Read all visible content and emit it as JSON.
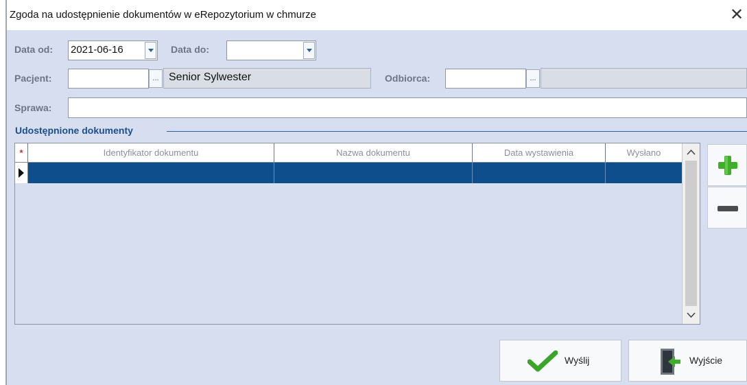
{
  "dialog": {
    "title": "Zgoda na udostępnienie dokumentów w eRepozytorium w chmurze",
    "close_glyph": "✕"
  },
  "filters": {
    "data_od_label": "Data od:",
    "data_od_value": "2021-06-16",
    "data_do_label": "Data do:",
    "data_do_value": "",
    "pacjent_label": "Pacjent:",
    "pacjent_code": "",
    "pacjent_name": "Senior Sylwester",
    "odbiorca_label": "Odbiorca:",
    "odbiorca_code": "",
    "odbiorca_name": "",
    "sprawa_label": "Sprawa:",
    "sprawa_value": "",
    "ellipsis": "..."
  },
  "documents": {
    "section_title": "Udostępnione dokumenty",
    "columns": [
      "Identyfikator dokumentu",
      "Nazwa dokumentu",
      "Data wystawienia",
      "Wysłano"
    ],
    "new_row_marker": "*",
    "rows": [
      {
        "id": "",
        "name": "",
        "date": "",
        "sent": ""
      }
    ]
  },
  "side_buttons": {
    "add_icon": "plus-icon",
    "remove_icon": "minus-icon"
  },
  "actions": {
    "send_label": "Wyślij",
    "exit_label": "Wyjście",
    "send_icon": "checkmark-icon",
    "exit_icon": "exit-door-icon"
  },
  "colors": {
    "client_bg": "#d7deef",
    "selection": "#0e4e8c",
    "section_title": "#1c4f8c",
    "add_green": "#3fae2a"
  }
}
